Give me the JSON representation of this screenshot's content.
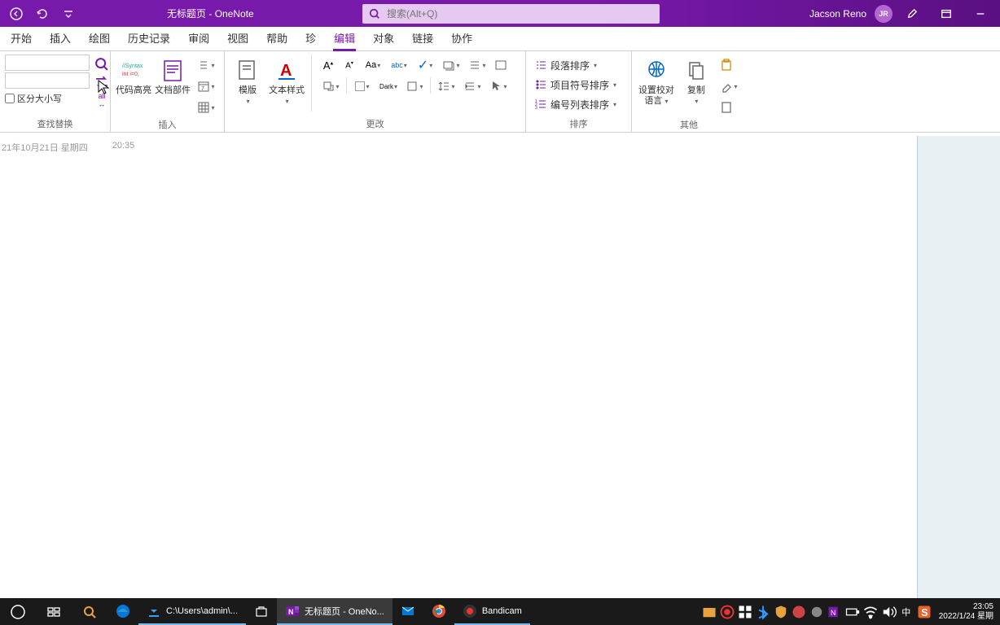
{
  "title": {
    "doc": "无标题页",
    "sep": " - ",
    "app": "OneNote"
  },
  "search": {
    "placeholder": "搜索(Alt+Q)"
  },
  "user": {
    "name": "Jacson Reno",
    "initials": "JR"
  },
  "tabs": [
    "开始",
    "插入",
    "绘图",
    "历史记录",
    "审阅",
    "视图",
    "帮助",
    "珍",
    "编辑",
    "对象",
    "链接",
    "协作"
  ],
  "active_tab": 8,
  "ribbon": {
    "groups": {
      "find_replace": {
        "label": "查找替换",
        "case_sensitive": "区分大小写"
      },
      "insert": {
        "label": "插入",
        "code_highlight": "代码高亮",
        "doc_parts": "文档部件"
      },
      "change": {
        "label": "更改",
        "template": "模版",
        "text_style": "文本样式"
      },
      "sort": {
        "label": "排序",
        "paragraph": "段落排序",
        "bullet": "项目符号排序",
        "number": "编号列表排序"
      },
      "other": {
        "label": "其他",
        "proof_lang": "设置校对语言",
        "copy": "复制"
      }
    }
  },
  "page": {
    "date": "21年10月21日 星期四",
    "time": "20:35"
  },
  "taskbar": {
    "apps": {
      "explorer": "C:\\Users\\admin\\...",
      "onenote": "无标题页 - OneNo...",
      "bandicam": "Bandicam"
    },
    "ime": "中",
    "clock": {
      "time": "23:05",
      "date": "2022/1/24 星期"
    }
  }
}
